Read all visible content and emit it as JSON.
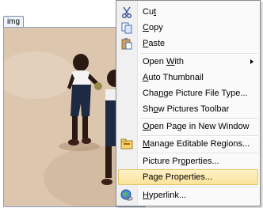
{
  "image_tag": {
    "label": "img"
  },
  "menu": {
    "items": [
      {
        "label": "Cut",
        "icon": "scissors-icon",
        "accel": "t"
      },
      {
        "label": "Copy",
        "icon": "copy-icon",
        "accel": "C"
      },
      {
        "label": "Paste",
        "icon": "paste-icon",
        "accel": "P"
      },
      {
        "label": "Open With",
        "icon": "",
        "accel": "W",
        "submenu": true
      },
      {
        "label": "Auto Thumbnail",
        "icon": "",
        "accel": "A"
      },
      {
        "label": "Change Picture File Type...",
        "icon": "",
        "accel": "n"
      },
      {
        "label": "Show Pictures Toolbar",
        "icon": "",
        "accel": "o"
      },
      {
        "label": "Open Page in New Window",
        "icon": "",
        "accel": "O"
      },
      {
        "label": "Manage Editable Regions...",
        "icon": "manage-regions-icon",
        "accel": "M"
      },
      {
        "label": "Picture Properties...",
        "icon": "",
        "accel": "o"
      },
      {
        "label": "Page Properties...",
        "icon": "",
        "accel": "g",
        "highlighted": true
      },
      {
        "label": "Hyperlink...",
        "icon": "hyperlink-globe-icon",
        "accel": "H"
      }
    ]
  },
  "colors": {
    "highlight_top": "#fdf1c8",
    "highlight_bottom": "#fbe39b",
    "highlight_border": "#e5c365",
    "menu_border": "#8d8d8d"
  }
}
